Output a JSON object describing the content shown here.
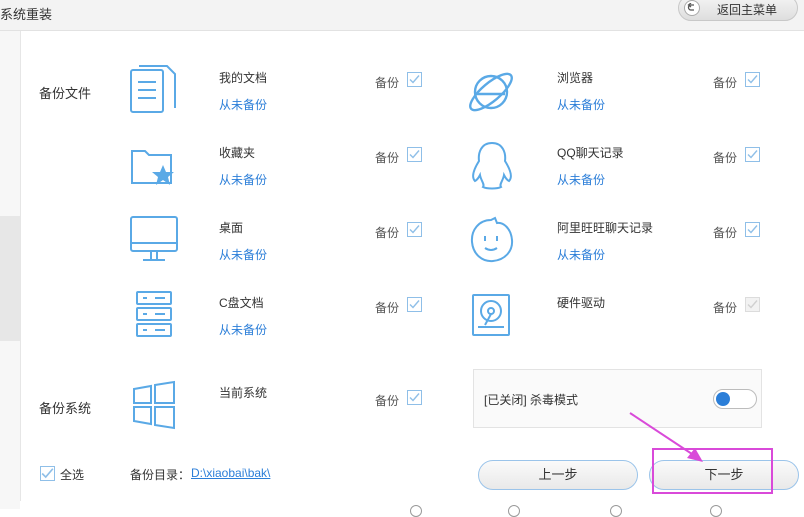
{
  "header": {
    "title": "系统重装",
    "return_label": "返回主菜单"
  },
  "sections": {
    "backup_files": "备份文件",
    "backup_system": "备份系统"
  },
  "backup_word": "备份",
  "items": [
    {
      "name": "我的文档",
      "status": "从未备份",
      "icon": "documents-icon",
      "checked": true
    },
    {
      "name": "浏览器",
      "status": "从未备份",
      "icon": "browser-icon",
      "checked": true
    },
    {
      "name": "收藏夹",
      "status": "从未备份",
      "icon": "favorites-folder-icon",
      "checked": true
    },
    {
      "name": "QQ聊天记录",
      "status": "从未备份",
      "icon": "qq-penguin-icon",
      "checked": true
    },
    {
      "name": "桌面",
      "status": "从未备份",
      "icon": "monitor-icon",
      "checked": true
    },
    {
      "name": "阿里旺旺聊天记录",
      "status": "从未备份",
      "icon": "aliwangwang-icon",
      "checked": true
    },
    {
      "name": "C盘文档",
      "status": "从未备份",
      "icon": "server-drive-icon",
      "checked": true
    },
    {
      "name": "硬件驱动",
      "status": "",
      "icon": "hardware-driver-icon",
      "checked": true,
      "disabled": true
    }
  ],
  "system_item": {
    "name": "当前系统",
    "icon": "windows-logo-icon",
    "checked": true
  },
  "kill_mode": {
    "label": "[已关闭] 杀毒模式",
    "on": false
  },
  "footer": {
    "select_all": "全选",
    "dir_label": "备份目录：",
    "dir_path": "D:\\xiaobai\\bak\\",
    "prev_label": "上一步",
    "next_label": "下一步"
  },
  "colors": {
    "accent": "#2b7ed8",
    "icon": "#5aa9e6",
    "highlight": "#d94ad9"
  }
}
